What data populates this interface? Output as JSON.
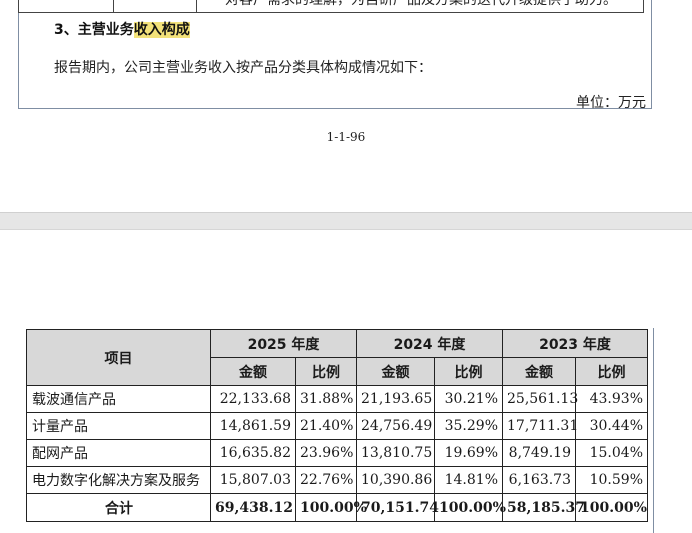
{
  "previous_table_row": {
    "text": "对客户需求的理解，为自研产品及方案的迭代升级提供了助力。"
  },
  "section": {
    "heading_prefix": "3、主营业务",
    "heading_highlight": "收入构成",
    "paragraph": "报告期内，公司主营业务收入按产品分类具体构成情况如下：",
    "unit": "单位：万元"
  },
  "page_number": "1-1-96",
  "table": {
    "header": {
      "item": "项目",
      "years": [
        "2025 年度",
        "2024 年度",
        "2023 年度"
      ],
      "amount": "金额",
      "ratio": "比例"
    },
    "rows": [
      {
        "label": "载波通信产品",
        "values": [
          "22,133.68",
          "31.88%",
          "21,193.65",
          "30.21%",
          "25,561.13",
          "43.93%"
        ]
      },
      {
        "label": "计量产品",
        "values": [
          "14,861.59",
          "21.40%",
          "24,756.49",
          "35.29%",
          "17,711.31",
          "30.44%"
        ]
      },
      {
        "label": "配网产品",
        "values": [
          "16,635.82",
          "23.96%",
          "13,810.75",
          "19.69%",
          "8,749.19",
          "15.04%"
        ]
      },
      {
        "label": "电力数字化解决方案及服务",
        "values": [
          "15,807.03",
          "22.76%",
          "10,390.86",
          "14.81%",
          "6,163.73",
          "10.59%"
        ]
      }
    ],
    "total": {
      "label": "合计",
      "values": [
        "69,438.12",
        "100.00%",
        "70,151.74",
        "100.00%",
        "58,185.37",
        "100.00%"
      ]
    }
  }
}
